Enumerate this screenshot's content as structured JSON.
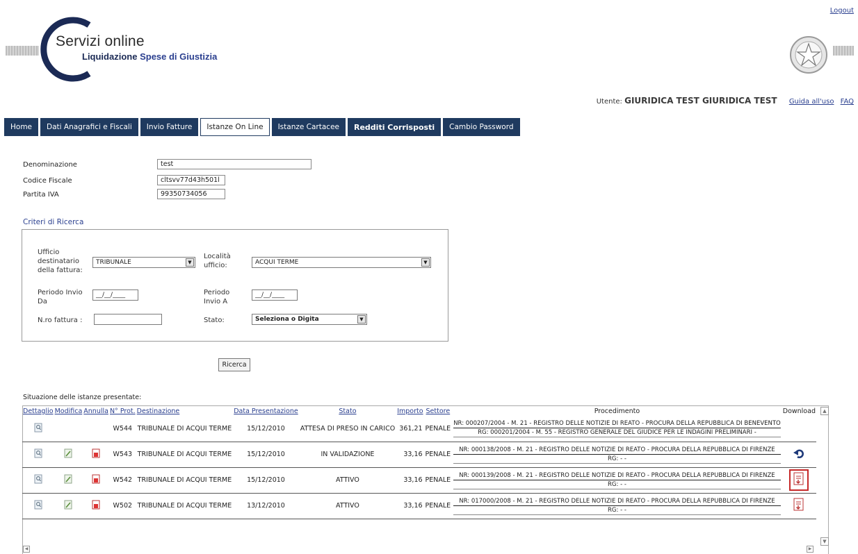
{
  "header": {
    "logout": "Logout",
    "logo_title": "Servizi online",
    "logo_sub_a": "Liquidazione",
    "logo_sub_b": "Spese di Giustizia",
    "user_label": "Utente:",
    "user_name": "GIURIDICA TEST GIURIDICA TEST",
    "guide": "Guida all'uso",
    "faq": "FAQ"
  },
  "tabs": [
    {
      "label": "Home"
    },
    {
      "label": "Dati Anagrafici e Fiscali"
    },
    {
      "label": "Invio Fatture"
    },
    {
      "label": "Istanze On Line"
    },
    {
      "label": "Istanze Cartacee"
    },
    {
      "label": "Redditi Corrisposti"
    },
    {
      "label": "Cambio Password"
    }
  ],
  "info": {
    "denominazione_label": "Denominazione",
    "denominazione_value": "test",
    "cf_label": "Codice Fiscale",
    "cf_value": "cltsvv77d43h501l",
    "piva_label": "Partita IVA",
    "piva_value": "99350734056"
  },
  "criteria": {
    "title": "Criteri di Ricerca",
    "ufficio_label_1": "Ufficio",
    "ufficio_label_2": "destinatario",
    "ufficio_label_3": "della fattura:",
    "ufficio_value": "TRIBUNALE",
    "localita_label_1": "Località",
    "localita_label_2": "ufficio:",
    "localita_value": "ACQUI TERME",
    "da_label_1": "Periodo Invio",
    "da_label_2": "Da",
    "da_value": "__/__/____",
    "a_label_1": "Periodo",
    "a_label_2": "Invio A",
    "a_value": "__/__/____",
    "nro_label": "N.ro fattura :",
    "stato_label": "Stato:",
    "stato_value": "Seleziona o Digita",
    "search_button": "Ricerca"
  },
  "results": {
    "title": "Situazione delle istanze presentate:",
    "columns": {
      "dettaglio": "Dettaglio",
      "modifica": "Modifica",
      "annulla": "Annulla",
      "prot": "N° Prot.",
      "destinazione": "Destinazione",
      "data": "Data Presentazione",
      "stato": "Stato",
      "importo": "Importo",
      "settore": "Settore",
      "procedimento": "Procedimento",
      "download": "Download"
    },
    "rows": [
      {
        "prot": "W544",
        "destinazione": "TRIBUNALE DI ACQUI TERME",
        "data": "15/12/2010",
        "stato": "ATTESA DI PRESO IN CARICO",
        "importo": "361,21",
        "settore": "PENALE",
        "nr": "NR: 000207/2004 - M. 21 - REGISTRO DELLE NOTIZIE DI REATO - PROCURA DELLA REPUBBLICA DI BENEVENTO",
        "rg": "RG: 000201/2004 - M. 55 - REGISTRO GENERALE DEL GIUDICE PER LE INDAGINI PRELIMINARI -"
      },
      {
        "prot": "W543",
        "destinazione": "TRIBUNALE DI ACQUI TERME",
        "data": "15/12/2010",
        "stato": "IN VALIDAZIONE",
        "importo": "33,16",
        "settore": "PENALE",
        "nr": "NR: 000138/2008 - M. 21 - REGISTRO DELLE NOTIZIE DI REATO - PROCURA DELLA REPUBBLICA DI FIRENZE",
        "rg": "RG: - -"
      },
      {
        "prot": "W542",
        "destinazione": "TRIBUNALE DI ACQUI TERME",
        "data": "15/12/2010",
        "stato": "ATTIVO",
        "importo": "33,16",
        "settore": "PENALE",
        "nr": "NR: 000139/2008 - M. 21 - REGISTRO DELLE NOTIZIE DI REATO - PROCURA DELLA REPUBBLICA DI FIRENZE",
        "rg": "RG: - -"
      },
      {
        "prot": "W502",
        "destinazione": "TRIBUNALE DI ACQUI TERME",
        "data": "13/12/2010",
        "stato": "ATTIVO",
        "importo": "33,16",
        "settore": "PENALE",
        "nr": "NR: 017000/2008 - M. 21 - REGISTRO DELLE NOTIZIE DI REATO - PROCURA DELLA REPUBBLICA DI FIRENZE",
        "rg": "RG: - -"
      }
    ]
  },
  "colors": {
    "nav": "#1f3a5f",
    "link": "#2a3f8f",
    "highlight": "#c62828"
  }
}
